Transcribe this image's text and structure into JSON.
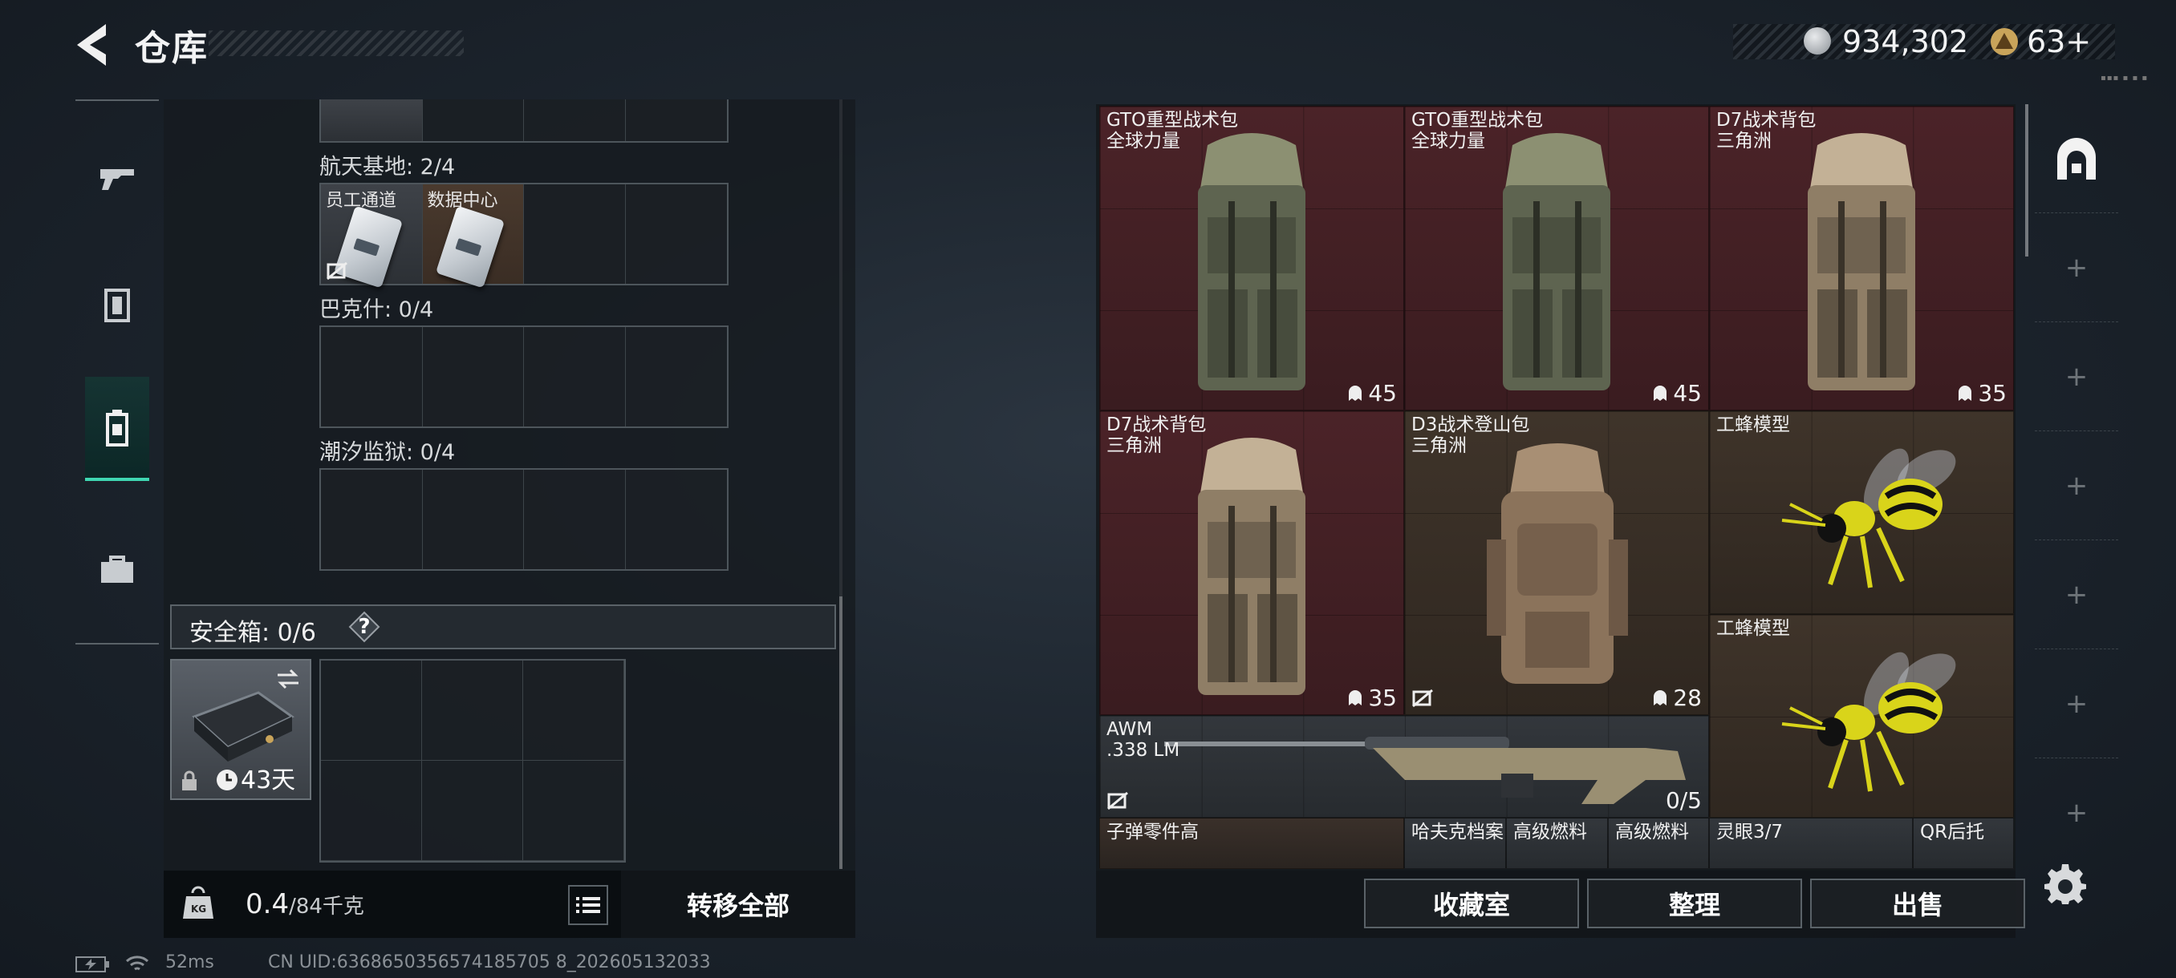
{
  "header": {
    "title": "仓库",
    "currency": [
      {
        "icon": "silver-coin-icon",
        "value": "934,302"
      },
      {
        "icon": "gold-triangle-icon",
        "value": "63+"
      }
    ]
  },
  "left_tabs": [
    {
      "icon": "gun-icon",
      "active": false
    },
    {
      "icon": "armor-icon",
      "active": false
    },
    {
      "icon": "backpack-icon",
      "active": true
    },
    {
      "icon": "briefcase-icon",
      "active": false
    }
  ],
  "inventory": {
    "sections": [
      {
        "label": "航天基地: 2/4",
        "cards": [
          "员工通道",
          "数据中心"
        ]
      },
      {
        "label": "巴克什: 0/4",
        "cards": []
      },
      {
        "label": "潮汐监狱: 0/4",
        "cards": []
      }
    ],
    "safe_box": {
      "label": "安全箱: 0/6",
      "help": "?",
      "duration": "43天"
    }
  },
  "weight": {
    "value": "0.4",
    "unit": "/84千克"
  },
  "transfer_all_label": "转移全部",
  "status": {
    "ping": "52ms",
    "uid": "CN UID:6368650356574185705 8_202605132033"
  },
  "stash_items": [
    {
      "name": "GTO重型战术包",
      "sub": "全球力量",
      "count": "45",
      "color": "red"
    },
    {
      "name": "GTO重型战术包",
      "sub": "全球力量",
      "count": "45",
      "color": "red"
    },
    {
      "name": "D7战术背包",
      "sub": "三角洲",
      "count": "35",
      "color": "red"
    },
    {
      "name": "D7战术背包",
      "sub": "三角洲",
      "count": "35",
      "color": "red"
    },
    {
      "name": "D3战术登山包",
      "sub": "三角洲",
      "count": "28",
      "color": "tan"
    },
    {
      "name": "工蜂模型",
      "sub": "",
      "count": "",
      "color": "tan"
    },
    {
      "name": "工蜂模型",
      "sub": "",
      "count": "",
      "color": "tan"
    },
    {
      "name": "AWM",
      "sub": ".338 LM",
      "count": "0/5",
      "color": "gray"
    }
  ],
  "stash_bottom_row": [
    "子弹零件高",
    "哈夫克档案",
    "高级燃料",
    "高级燃料",
    "灵眼3/7",
    "QR后托"
  ],
  "actions": [
    "收藏室",
    "整理",
    "出售"
  ],
  "colors": {
    "accent": "#3fd7b2",
    "red_item": "#4b2328",
    "tan_item": "#3f342a"
  }
}
